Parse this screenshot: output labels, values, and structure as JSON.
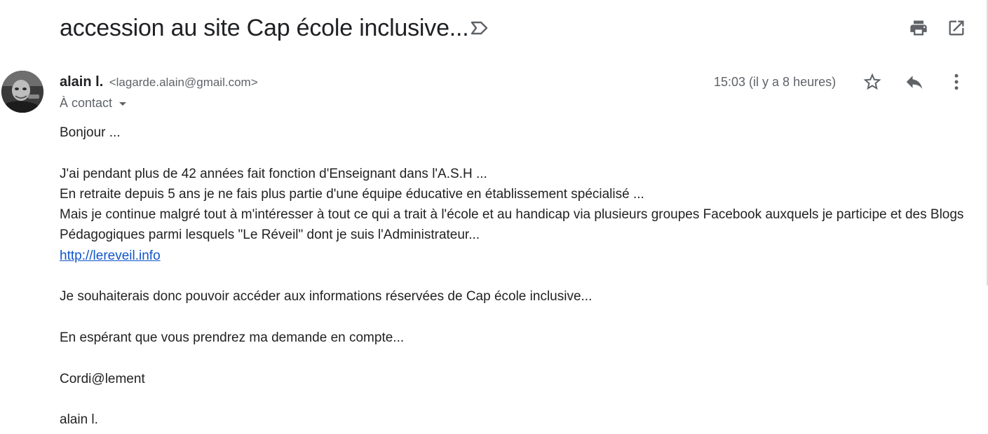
{
  "subject": "accession au site Cap école inclusive...",
  "toolbar": {
    "label_icon": "label-outline-icon",
    "print_icon": "print-icon",
    "popout_icon": "open-in-new-window-icon"
  },
  "sender": {
    "name": "alain l.",
    "email": "<lagarde.alain@gmail.com>",
    "to": "À contact",
    "avatar": "sender-avatar-photo"
  },
  "message_meta": {
    "time": "15:03 (il y a 8 heures)",
    "star_icon": "star-outline-icon",
    "reply_icon": "reply-icon",
    "more_icon": "more-vert-icon"
  },
  "body": {
    "greeting": "Bonjour ...",
    "line1": "J'ai pendant plus de 42 années fait fonction d'Enseignant dans l'A.S.H ...",
    "line2": "En retraite depuis 5 ans je ne fais plus partie d'une équipe éducative en établissement spécialisé ...",
    "line3": "Mais je continue malgré tout à m'intéresser à tout ce qui a trait à l'école et au handicap via plusieurs groupes Facebook auxquels je participe et des Blogs Pédagogiques parmi lesquels \"Le Réveil\" dont je suis l'Administrateur...",
    "link": "http://lereveil.info",
    "request": "Je souhaiterais donc pouvoir accéder aux informations réservées de Cap école inclusive...",
    "hope": "En espérant que vous prendrez ma demande en compte...",
    "closing": "Cordi@lement",
    "signature": "alain l."
  },
  "colors": {
    "text": "#222222",
    "secondary": "#5f6368",
    "link": "#1155cc",
    "icon": "#5f6368"
  }
}
